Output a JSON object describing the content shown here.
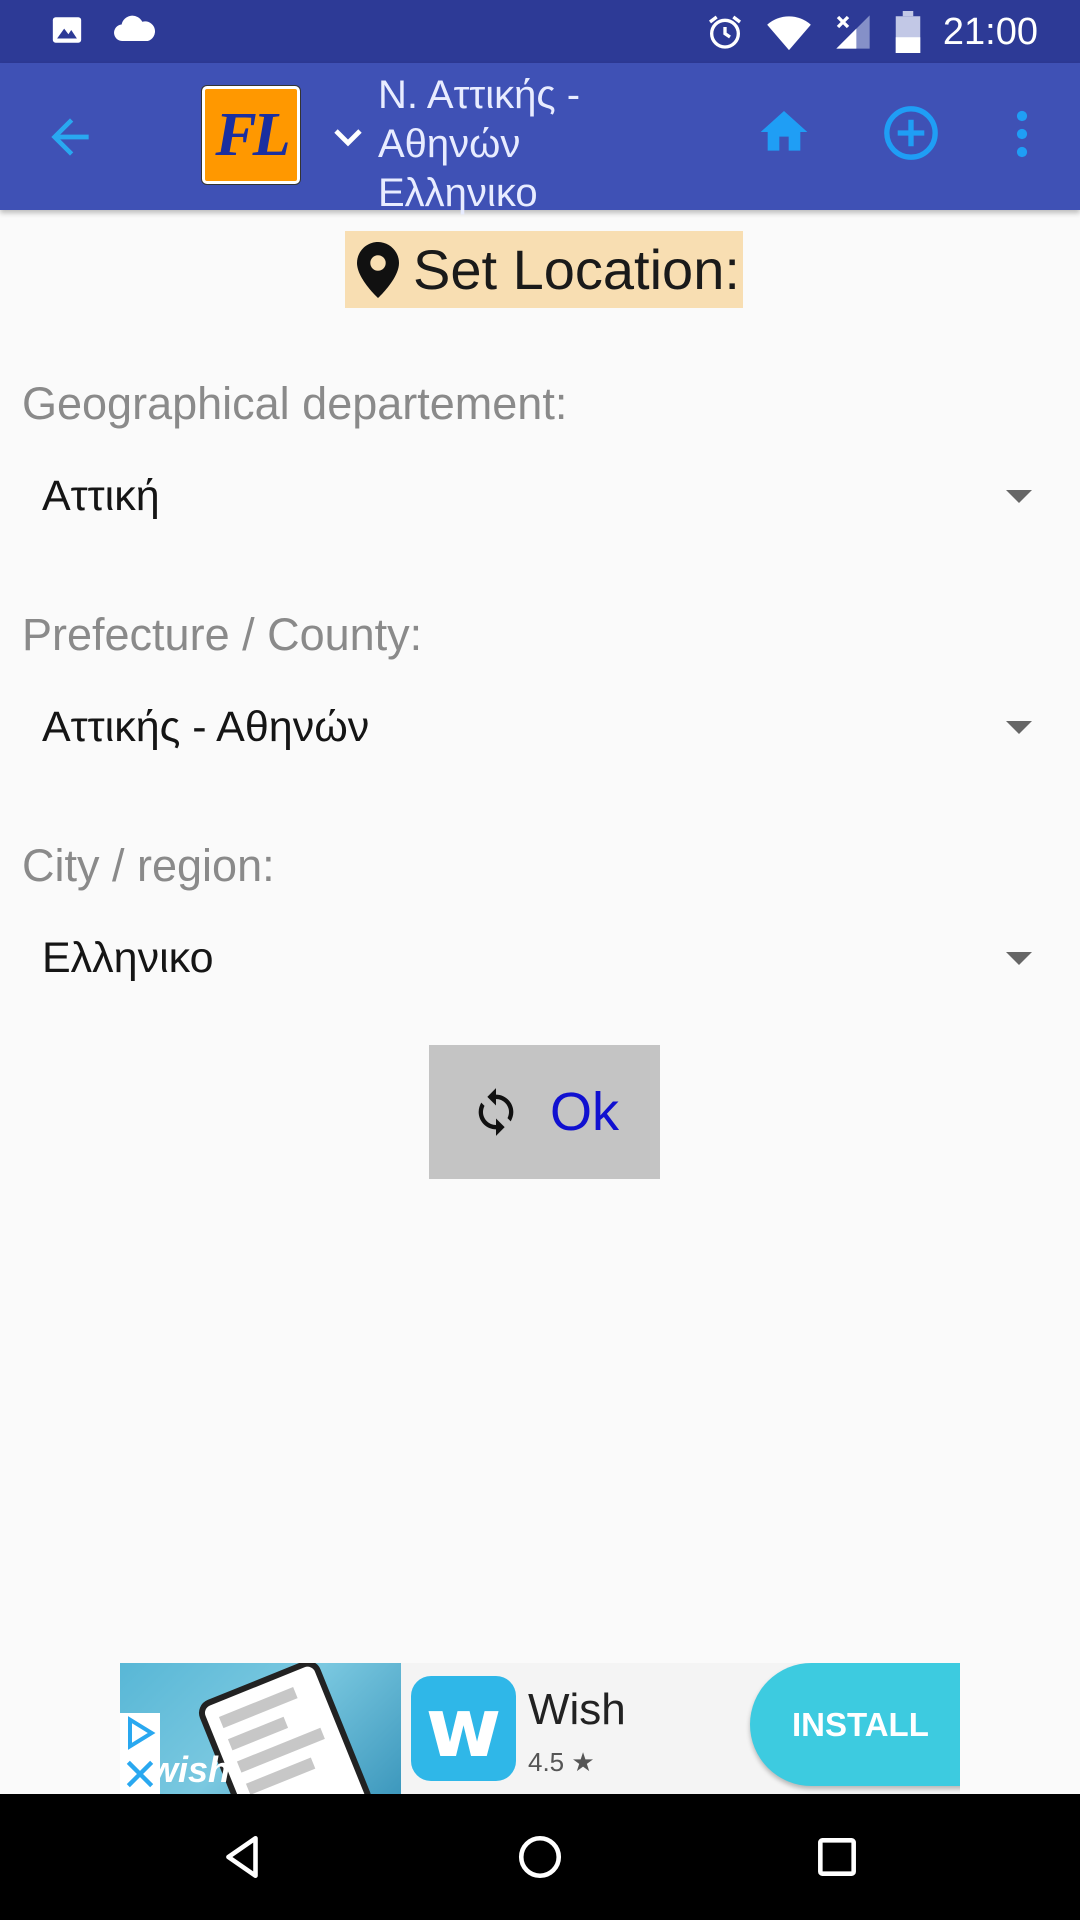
{
  "status_bar": {
    "time": "21:00",
    "left_icons": [
      "image-icon",
      "cloud-icon"
    ],
    "right_icons": [
      "alarm-icon",
      "wifi-icon",
      "signal-icon",
      "battery-icon"
    ]
  },
  "app_bar": {
    "logo_text": "FL",
    "title_lines": [
      "Ν. Αττικής -",
      "Αθηνών",
      "Ελληνικο"
    ],
    "icons": [
      "arrow-back-icon",
      "chevron-down-icon",
      "home-icon",
      "add-circle-icon",
      "more-vert-icon"
    ]
  },
  "heading": {
    "label": "Set Location:",
    "icon": "location-pin-icon"
  },
  "fields": [
    {
      "label": "Geographical departement:",
      "value": "Αττική"
    },
    {
      "label": "Prefecture / County:",
      "value": "Αττικής - Αθηνών"
    },
    {
      "label": "City / region:",
      "value": "Ελληνικο"
    }
  ],
  "ok_button": {
    "label": "Ok",
    "icon": "refresh-icon"
  },
  "ad": {
    "app_name": "Wish",
    "rating": "4.5",
    "install_label": "INSTALL",
    "image_wordmark": "wish",
    "app_icon_letter": "w"
  },
  "nav_bar": {
    "icons": [
      "nav-back-icon",
      "nav-home-icon",
      "nav-recents-icon"
    ]
  },
  "colors": {
    "status_bar": "#2d3a96",
    "app_bar": "#3f51b5",
    "accent_blue": "#29a8f0",
    "heading_bg": "#f8deb2",
    "ok_button_bg": "#c4c4c4",
    "ok_text": "#1010d0",
    "install_bg": "#3dcbe0"
  }
}
